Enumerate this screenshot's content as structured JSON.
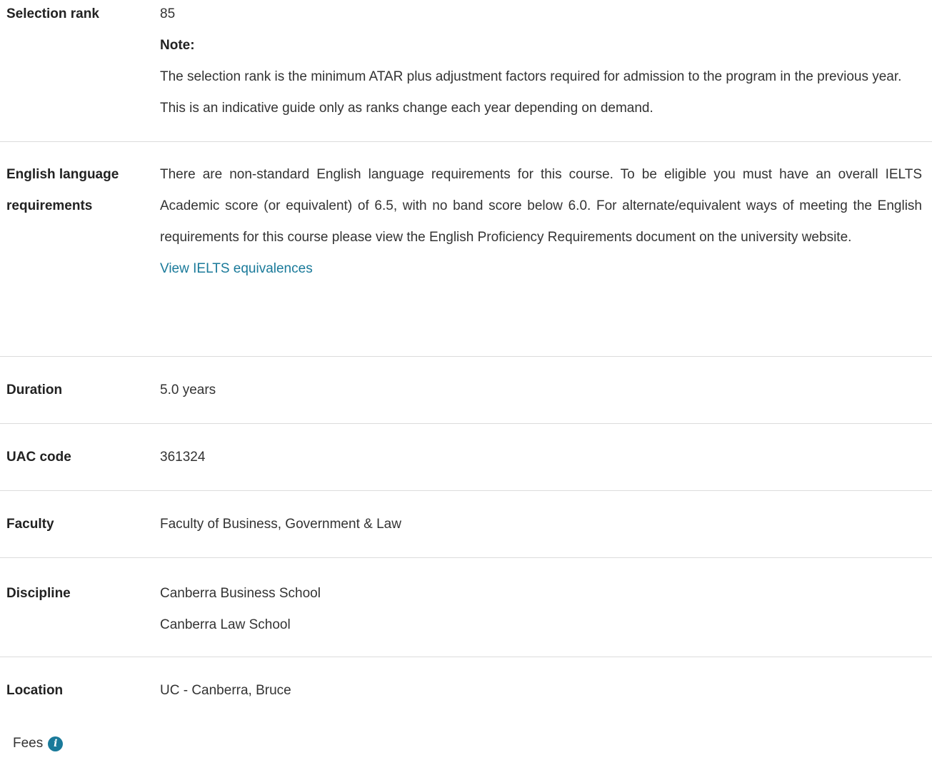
{
  "selection_rank": {
    "label": "Selection rank",
    "value": "85",
    "note_label": "Note:",
    "note_text": "The selection rank is the minimum ATAR plus adjustment factors required for admission to the program in the previous year. This is an indicative guide only as ranks change each year depending on demand."
  },
  "english": {
    "label": "English language requirements",
    "text": "There are non-standard English language requirements for this course. To be eligible you must have an overall IELTS Academic score (or equivalent) of 6.5, with no band score below 6.0. For alternate/equivalent ways of meeting the English requirements for this course please view the English Proficiency Requirements document on the university website.",
    "link_label": "View IELTS equivalences"
  },
  "duration": {
    "label": "Duration",
    "value": "5.0 years"
  },
  "uac_code": {
    "label": "UAC code",
    "value": "361324"
  },
  "faculty": {
    "label": "Faculty",
    "value": "Faculty of Business, Government & Law"
  },
  "discipline": {
    "label": "Discipline",
    "values": [
      "Canberra Business School",
      "Canberra Law School"
    ]
  },
  "location": {
    "label": "Location",
    "value": "UC - Canberra, Bruce"
  },
  "fees": {
    "label": "Fees",
    "icon": "info-icon",
    "icon_color": "#1a7a9a"
  },
  "colors": {
    "link": "#1a7a9a",
    "divider": "#dcdcdc"
  }
}
